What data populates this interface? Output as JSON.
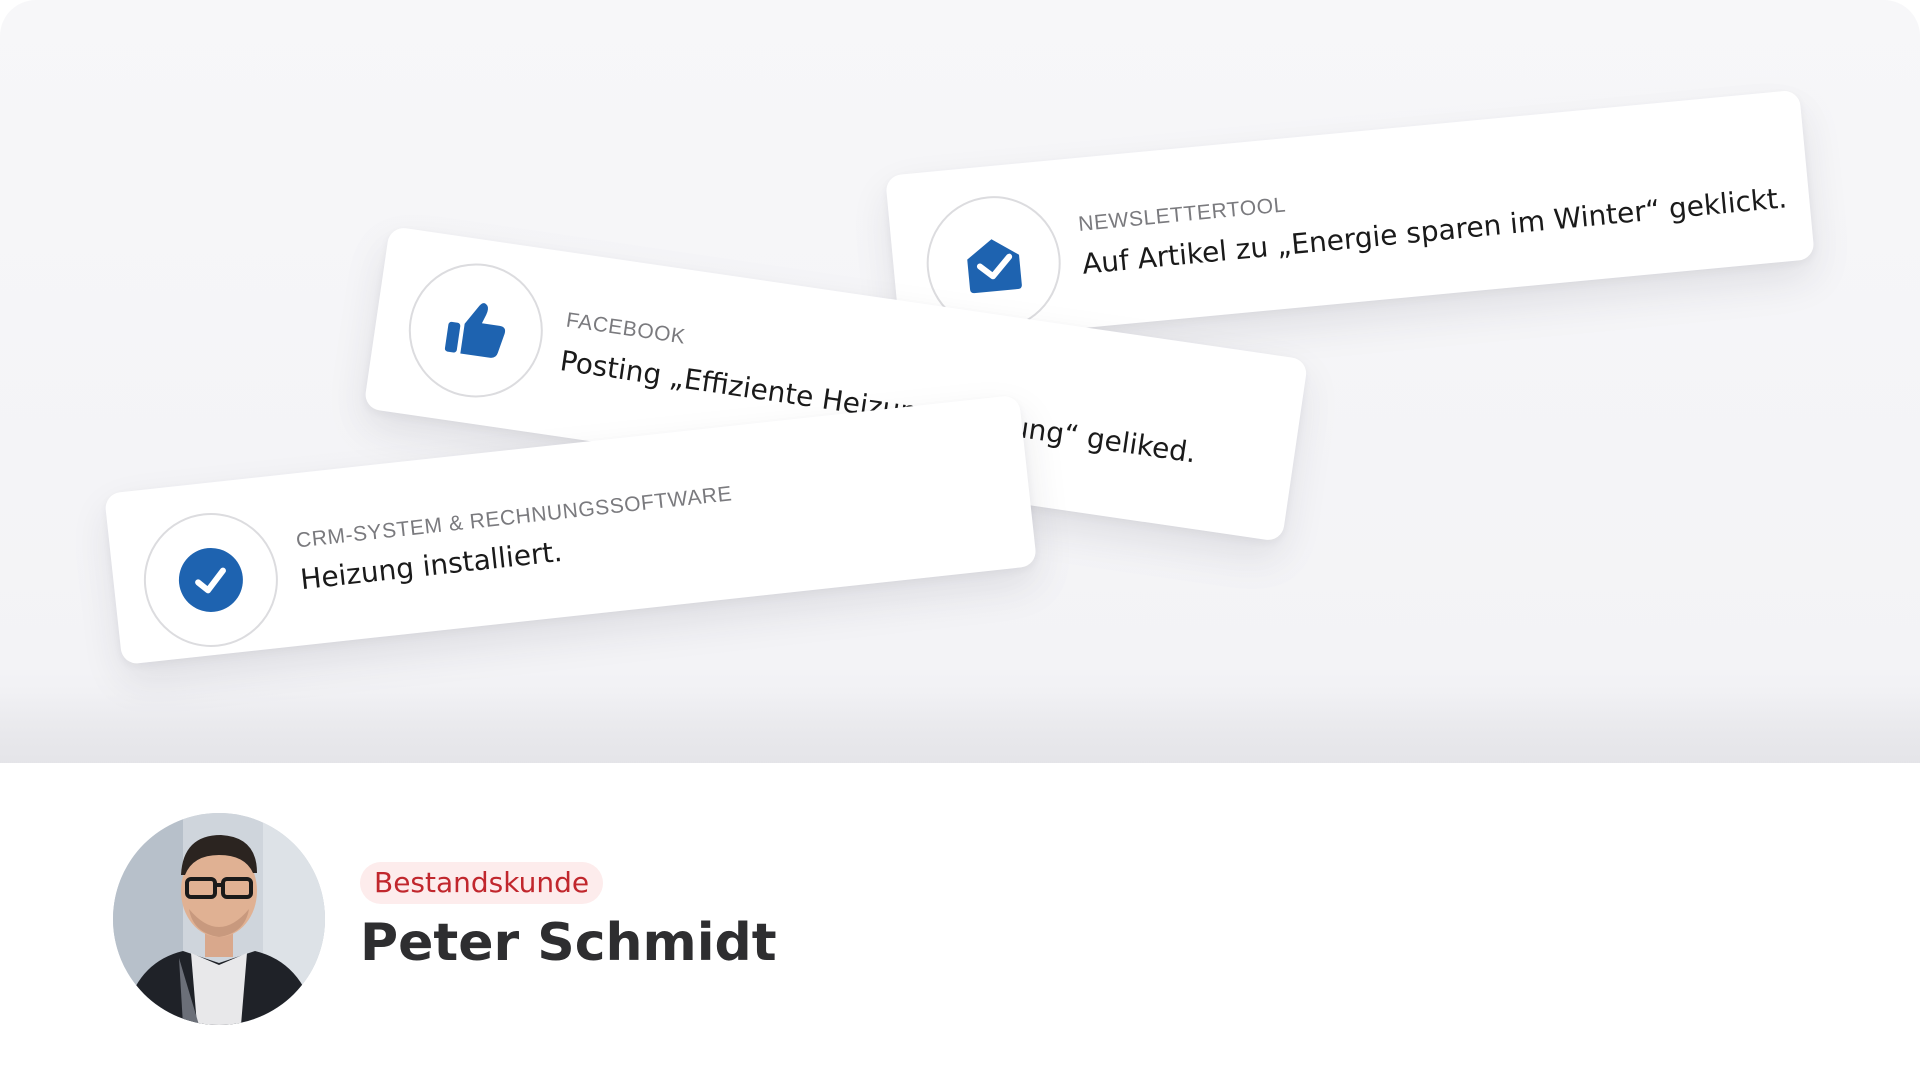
{
  "activity_cards": [
    {
      "source": "NEWSLETTERTOOL",
      "message": "Auf Artikel zu „Energie sparen im Winter“ geklickt.",
      "icon": "envelope-open-icon"
    },
    {
      "source": "FACEBOOK",
      "message": "Posting „Effiziente Heizungswartung“ geliked.",
      "icon": "thumbs-up-icon"
    },
    {
      "source": "CRM-SYSTEM & RECHNUNGSSOFTWARE",
      "message": "Heizung installiert.",
      "icon": "check-circle-icon"
    }
  ],
  "profile": {
    "tag": "Bestandskunde",
    "name": "Peter Schmidt",
    "avatar": "avatar-photo"
  },
  "colors": {
    "icon_blue": "#1e63b0",
    "tag_text": "#c1272d",
    "tag_bg": "#fdecec",
    "name_text": "#2e2e30",
    "background": "#f5f5f7"
  }
}
